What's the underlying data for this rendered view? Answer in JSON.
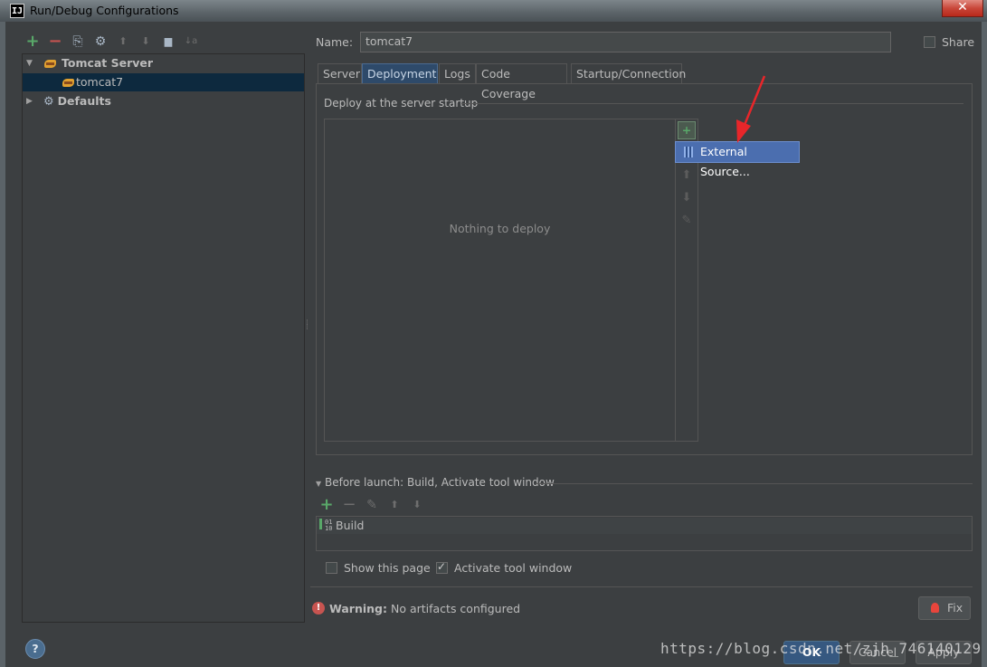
{
  "window": {
    "app_icon": "IJ",
    "title": "Run/Debug Configurations",
    "close_icon": "✕"
  },
  "left_toolbar": {
    "icons": [
      "add-icon",
      "remove-icon",
      "copy-icon",
      "edit-defaults-icon",
      "move-up-icon",
      "move-down-icon",
      "folder-icon",
      "sort-icon"
    ],
    "glyphs": {
      "add": "+",
      "remove": "−",
      "copy": "⎘",
      "defaults": "⚙",
      "up": "⬆",
      "down": "⬇",
      "folder": "▆",
      "sort": "↓a"
    }
  },
  "tree": {
    "items": [
      {
        "label": "Tomcat Server",
        "expanded": true
      },
      {
        "label": "tomcat7",
        "selected": true
      },
      {
        "label": "Defaults",
        "expanded": false
      }
    ]
  },
  "form": {
    "name_label": "Name:",
    "name_value": "tomcat7",
    "share_label": "Share",
    "share_checked": false
  },
  "tabs": [
    {
      "label": "Server"
    },
    {
      "label": "Deployment",
      "active": true
    },
    {
      "label": "Logs"
    },
    {
      "label": "Code Coverage"
    },
    {
      "label": "Startup/Connection"
    }
  ],
  "deployment": {
    "section_title": "Deploy at the server startup",
    "empty_text": "Nothing to deploy",
    "add_glyph": "+",
    "popup_item": "External Source...",
    "side_glyphs": {
      "up": "⬆",
      "down": "⬇",
      "edit": "✎"
    }
  },
  "before_launch": {
    "title": "Before launch: Build, Activate tool window",
    "toolbar_glyphs": {
      "add": "+",
      "remove": "−",
      "edit": "✎",
      "up": "⬆",
      "down": "⬇"
    },
    "items": [
      "Build"
    ],
    "show_page_label": "Show this page",
    "show_page_checked": false,
    "activate_label": "Activate tool window",
    "activate_checked": true
  },
  "warning": {
    "icon": "!",
    "bold": "Warning:",
    "text": "No artifacts configured",
    "fix_label": "Fix"
  },
  "footer": {
    "help_label": "?",
    "ok_label": "OK",
    "cancel_label": "Cancel",
    "apply_label": "Apply",
    "watermark": "https://blog.csdn.net/zjh_746140129"
  },
  "colors": {
    "background": "#3c3f41",
    "selection": "#0d293e",
    "accent": "#4b6eaf",
    "annotation_arrow": "#e8262a"
  }
}
